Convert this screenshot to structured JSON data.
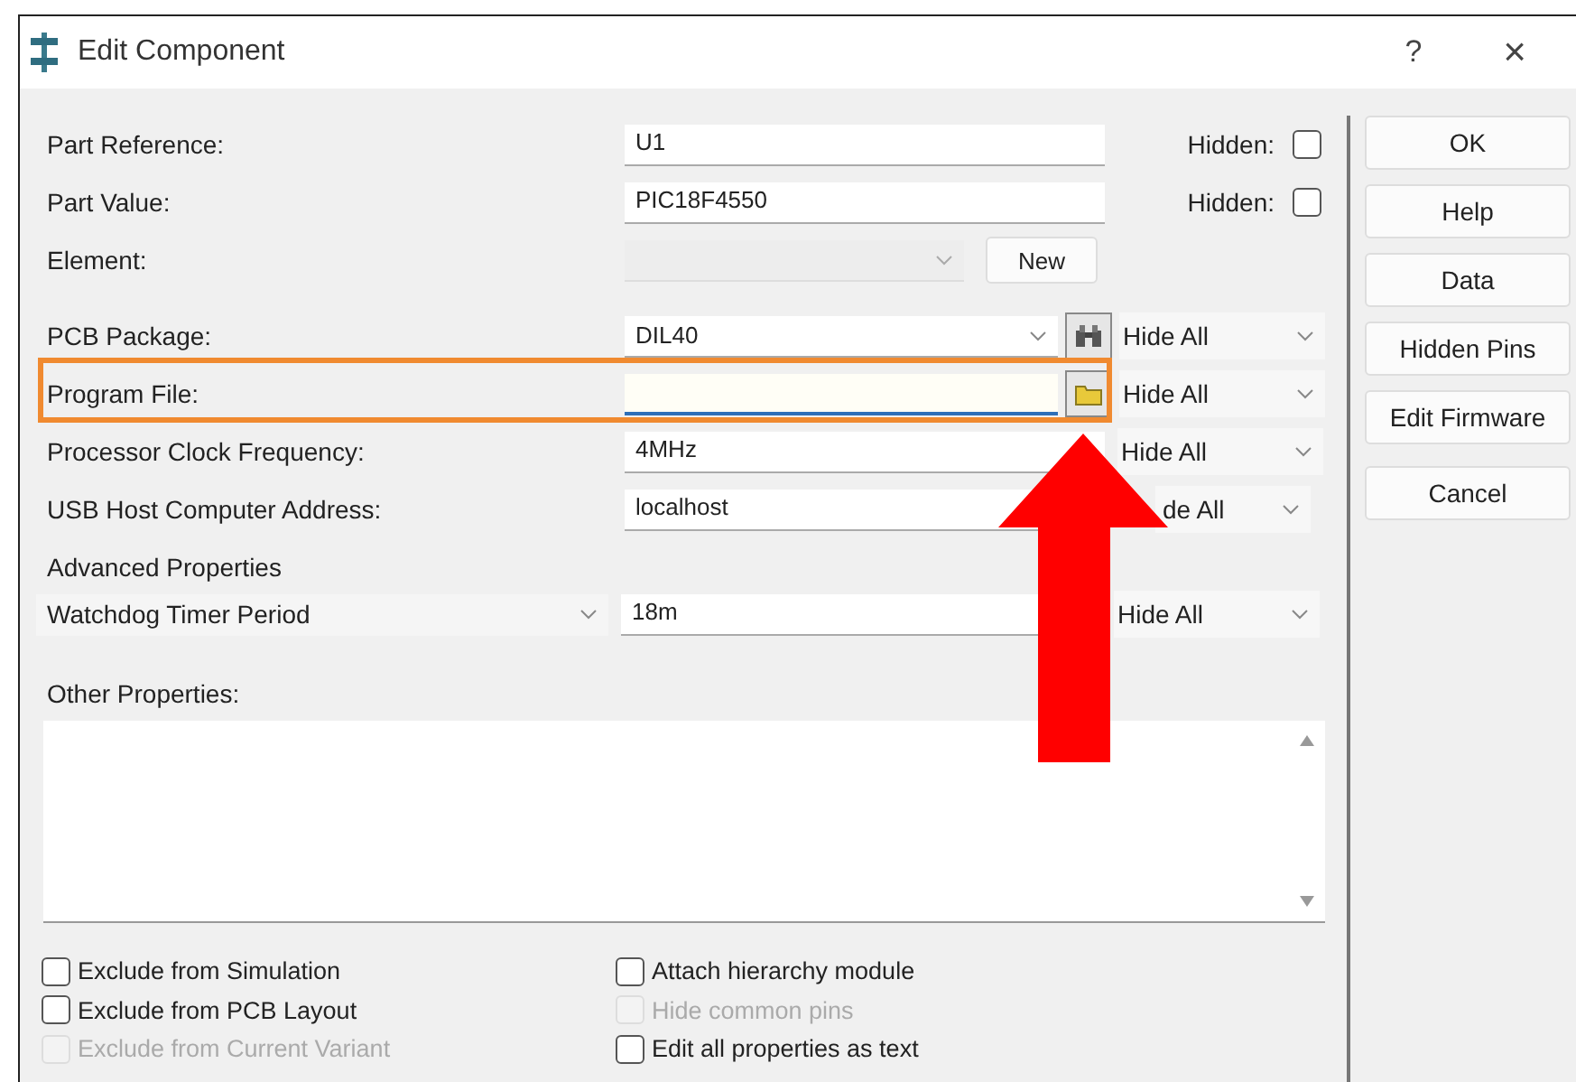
{
  "window": {
    "title": "Edit Component",
    "help": "?",
    "close": "×"
  },
  "fields": [
    {
      "kind": "text",
      "label": "Part Reference:",
      "value": "U1",
      "hidden_label": "Hidden:",
      "hidden": false
    },
    {
      "kind": "text",
      "label": "Part Value:",
      "value": "PIC18F4550",
      "hidden_label": "Hidden:",
      "hidden": false
    },
    {
      "kind": "element",
      "label": "Element:",
      "disabled": true,
      "button": "New"
    },
    {
      "kind": "package",
      "label": "PCB Package:",
      "value": "DIL40",
      "visibility": "Hide All"
    },
    {
      "kind": "file",
      "label": "Program File:",
      "focused": true,
      "highlighted": true,
      "visibility": "Hide All"
    },
    {
      "kind": "text",
      "label": "Processor Clock Frequency:",
      "value": "4MHz",
      "visibility": "Hide All"
    },
    {
      "kind": "text",
      "label": "USB Host Computer Address:",
      "value": "localhost",
      "visibility": "de All"
    }
  ],
  "advanced": {
    "label": "Advanced Properties",
    "property": "Watchdog Timer Period",
    "value": "18m",
    "visibility": "Hide All"
  },
  "other": {
    "label": "Other Properties:"
  },
  "options_left": [
    {
      "label": "Exclude from Simulation",
      "checked": false,
      "disabled": false
    },
    {
      "label": "Exclude from PCB Layout",
      "checked": false,
      "disabled": false
    },
    {
      "label": "Exclude from Current Variant",
      "checked": false,
      "disabled": true
    }
  ],
  "options_right": [
    {
      "label": "Attach hierarchy module",
      "checked": false,
      "disabled": false
    },
    {
      "label": "Hide common pins",
      "checked": false,
      "disabled": true
    },
    {
      "label": "Edit all properties as text",
      "checked": false,
      "disabled": false
    }
  ],
  "buttons": [
    {
      "label": "OK"
    },
    {
      "label": "Help"
    },
    {
      "label": "Data"
    },
    {
      "label": "Hidden Pins"
    },
    {
      "label": "Edit Firmware"
    },
    {
      "label": "Cancel"
    }
  ]
}
